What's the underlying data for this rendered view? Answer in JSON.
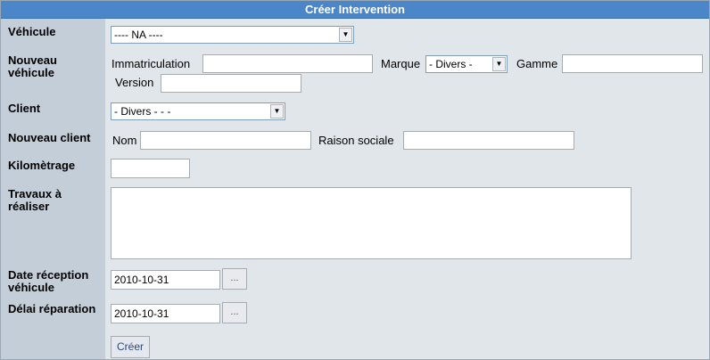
{
  "form": {
    "title": "Créer Intervention"
  },
  "vehicule": {
    "label": "Véhicule",
    "selected": "---- NA ----"
  },
  "nouveau_vehicule": {
    "label": "Nouveau véhicule",
    "immatriculation_label": "Immatriculation",
    "immatriculation_value": "",
    "marque_label": "Marque",
    "marque_selected": "- Divers -",
    "gamme_label": "Gamme",
    "gamme_value": "",
    "version_label": "Version",
    "version_value": ""
  },
  "client": {
    "label": "Client",
    "selected": "- Divers - - -"
  },
  "nouveau_client": {
    "label": "Nouveau client",
    "nom_label": "Nom",
    "nom_value": "",
    "raison_label": "Raison sociale",
    "raison_value": ""
  },
  "kilometrage": {
    "label": "Kilomètrage",
    "value": ""
  },
  "travaux": {
    "label": "Travaux à réaliser",
    "value": ""
  },
  "date_reception": {
    "label": "Date réception véhicule",
    "value": "2010-10-31",
    "picker_label": "..."
  },
  "delai_reparation": {
    "label": "Délai réparation",
    "value": "2010-10-31",
    "picker_label": "..."
  },
  "submit": {
    "label": "Créer"
  },
  "colors": {
    "title_bg": "#4a86c8",
    "label_col_bg": "#c4ced9",
    "form_bg": "#e1e6ea"
  },
  "icons": {
    "dropdown": "chevron-down-icon"
  }
}
